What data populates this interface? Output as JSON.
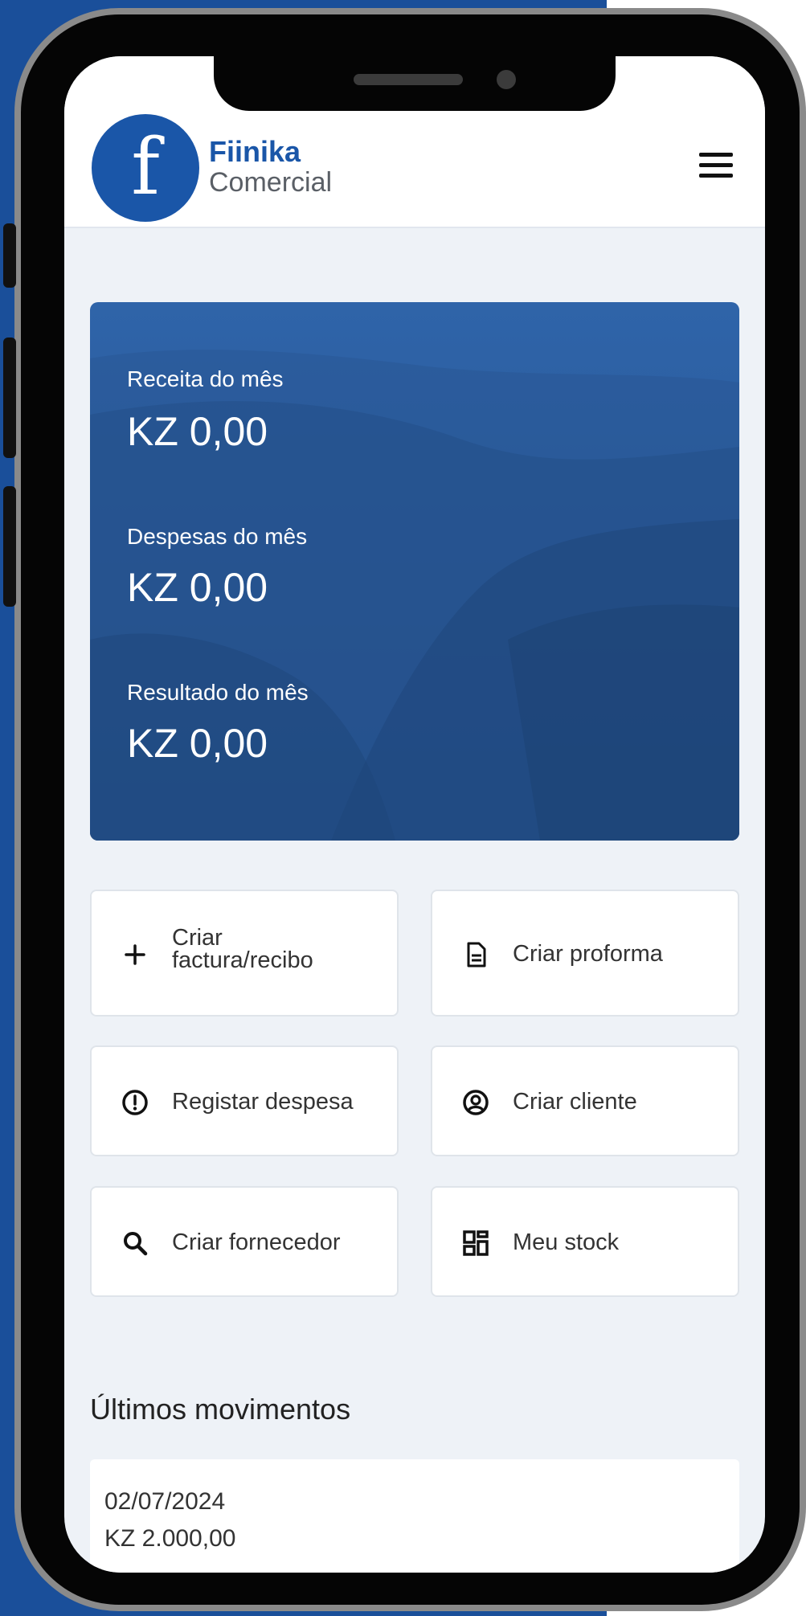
{
  "brand": {
    "logo_letter": "f",
    "name": "Fiinika",
    "subtitle": "Comercial"
  },
  "summary": {
    "revenue_label": "Receita do mês",
    "revenue_value": "KZ 0,00",
    "expenses_label": "Despesas do mês",
    "expenses_value": "KZ 0,00",
    "result_label": "Resultado do mês",
    "result_value": "KZ 0,00"
  },
  "actions": {
    "create_invoice_line1": "Criar",
    "create_invoice_line2": "factura/recibo",
    "create_proforma": "Criar proforma",
    "register_expense": "Registar despesa",
    "create_client": "Criar cliente",
    "create_supplier": "Criar fornecedor",
    "my_stock": "Meu stock"
  },
  "movements": {
    "title": "Últimos movimentos",
    "items": [
      {
        "date": "02/07/2024",
        "amount": "KZ 2.000,00"
      }
    ]
  },
  "colors": {
    "brand_blue": "#1a56a8",
    "frame_blue": "#1a4f9a",
    "hero_blue": "#2a5c9d"
  }
}
